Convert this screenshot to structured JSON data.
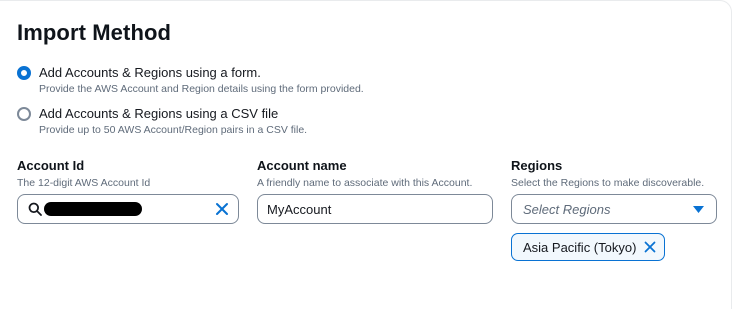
{
  "title": "Import Method",
  "options": [
    {
      "label": "Add Accounts & Regions using a form.",
      "description": "Provide the AWS Account and Region details using the form provided.",
      "selected": true
    },
    {
      "label": "Add Accounts & Regions using a CSV file",
      "description": "Provide up to 50 AWS Account/Region pairs in a CSV file.",
      "selected": false
    }
  ],
  "fields": {
    "account_id": {
      "label": "Account Id",
      "description": "The 12-digit AWS Account Id",
      "value": "[redacted]"
    },
    "account_name": {
      "label": "Account name",
      "description": "A friendly name to associate with this Account.",
      "value": "MyAccount"
    },
    "regions": {
      "label": "Regions",
      "description": "Select the Regions to make discoverable.",
      "placeholder": "Select Regions",
      "selected": [
        "Asia Pacific (Tokyo)"
      ]
    }
  },
  "colors": {
    "accent": "#0972d3",
    "border": "#7d8998",
    "muted_text": "#5f6b7a"
  },
  "icons": {
    "search": "search-icon",
    "clear": "close-icon",
    "dropdown": "caret-down-icon",
    "token_remove": "close-icon"
  }
}
